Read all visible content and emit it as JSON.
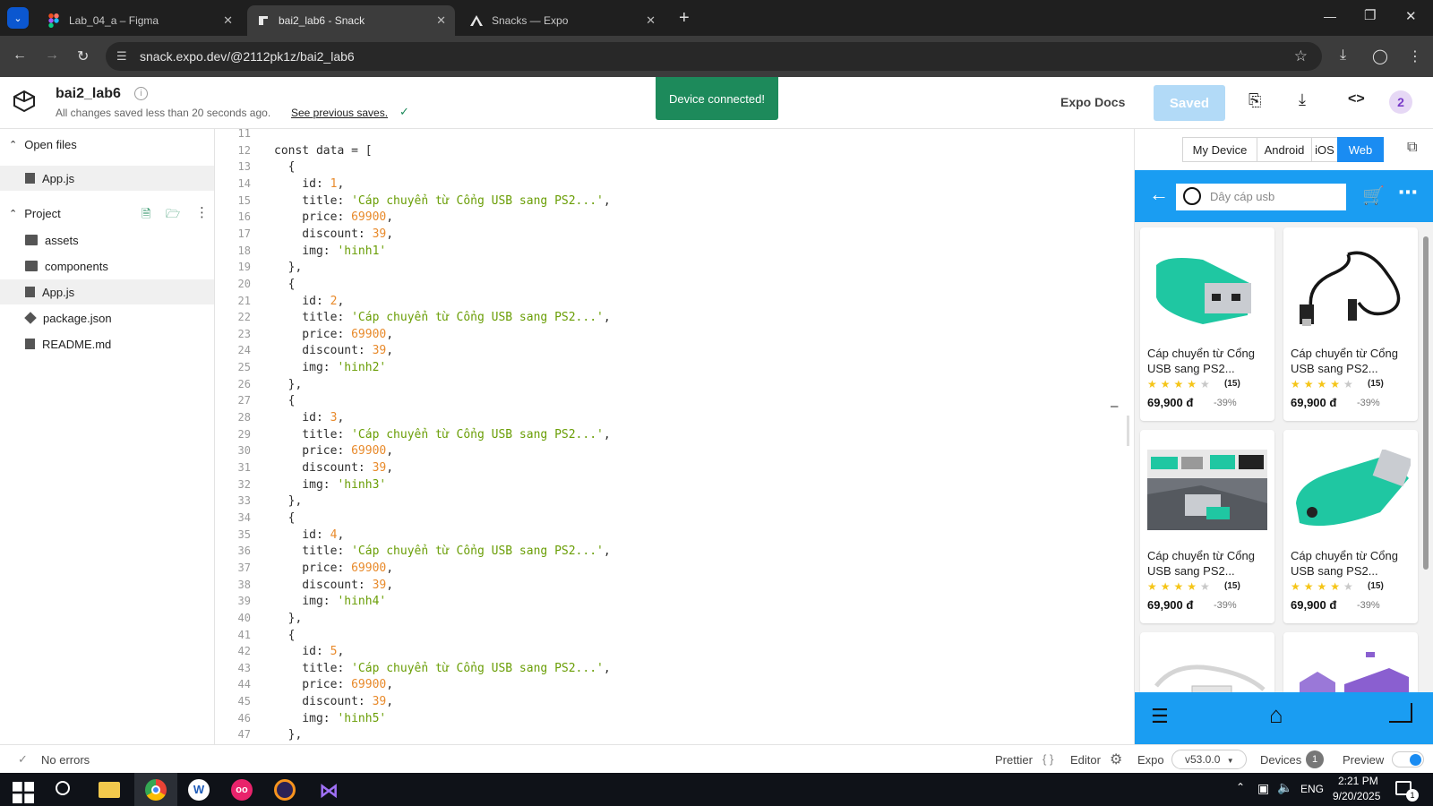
{
  "browser": {
    "tabs": [
      {
        "title": "Lab_04_a – Figma",
        "icon": "figma-icon"
      },
      {
        "title": "bai2_lab6 - Snack",
        "icon": "snack-icon"
      },
      {
        "title": "Snacks — Expo",
        "icon": "expo-icon"
      }
    ],
    "url": "snack.expo.dev/@2112pk1z/bai2_lab6"
  },
  "snack": {
    "project_name": "bai2_lab6",
    "save_status": "All changes saved less than 20 seconds ago.",
    "previous_saves_link": "See previous saves.",
    "toast": "Device connected!",
    "docs_link": "Expo Docs",
    "saved_button": "Saved",
    "avatar_badge": "2"
  },
  "sidebar": {
    "open_files_label": "Open files",
    "open_files": [
      "App.js"
    ],
    "project_label": "Project",
    "items": [
      {
        "name": "assets",
        "type": "folder"
      },
      {
        "name": "components",
        "type": "folder"
      },
      {
        "name": "App.js",
        "type": "js"
      },
      {
        "name": "package.json",
        "type": "package"
      },
      {
        "name": "README.md",
        "type": "md"
      }
    ]
  },
  "editor": {
    "lines": [
      {
        "n": "11",
        "tokens": [
          {
            "t": ""
          }
        ]
      },
      {
        "n": "12",
        "tokens": [
          {
            "t": "const data = ["
          }
        ]
      },
      {
        "n": "13",
        "tokens": [
          {
            "t": "  {"
          }
        ]
      },
      {
        "n": "14",
        "tokens": [
          {
            "t": "    id: "
          },
          {
            "t": "1",
            "c": "num"
          },
          {
            "t": ","
          }
        ]
      },
      {
        "n": "15",
        "tokens": [
          {
            "t": "    title: "
          },
          {
            "t": "'Cáp chuyển từ Cổng USB sang PS2...'",
            "c": "str"
          },
          {
            "t": ","
          }
        ]
      },
      {
        "n": "16",
        "tokens": [
          {
            "t": "    price: "
          },
          {
            "t": "69900",
            "c": "num"
          },
          {
            "t": ","
          }
        ]
      },
      {
        "n": "17",
        "tokens": [
          {
            "t": "    discount: "
          },
          {
            "t": "39",
            "c": "num"
          },
          {
            "t": ","
          }
        ]
      },
      {
        "n": "18",
        "tokens": [
          {
            "t": "    img: "
          },
          {
            "t": "'hinh1'",
            "c": "str"
          }
        ]
      },
      {
        "n": "19",
        "tokens": [
          {
            "t": "  },"
          }
        ]
      },
      {
        "n": "20",
        "tokens": [
          {
            "t": "  {"
          }
        ]
      },
      {
        "n": "21",
        "tokens": [
          {
            "t": "    id: "
          },
          {
            "t": "2",
            "c": "num"
          },
          {
            "t": ","
          }
        ]
      },
      {
        "n": "22",
        "tokens": [
          {
            "t": "    title: "
          },
          {
            "t": "'Cáp chuyển từ Cổng USB sang PS2...'",
            "c": "str"
          },
          {
            "t": ","
          }
        ]
      },
      {
        "n": "23",
        "tokens": [
          {
            "t": "    price: "
          },
          {
            "t": "69900",
            "c": "num"
          },
          {
            "t": ","
          }
        ]
      },
      {
        "n": "24",
        "tokens": [
          {
            "t": "    discount: "
          },
          {
            "t": "39",
            "c": "num"
          },
          {
            "t": ","
          }
        ]
      },
      {
        "n": "25",
        "tokens": [
          {
            "t": "    img: "
          },
          {
            "t": "'hinh2'",
            "c": "str"
          }
        ]
      },
      {
        "n": "26",
        "tokens": [
          {
            "t": "  },"
          }
        ]
      },
      {
        "n": "27",
        "tokens": [
          {
            "t": "  {"
          }
        ]
      },
      {
        "n": "28",
        "tokens": [
          {
            "t": "    id: "
          },
          {
            "t": "3",
            "c": "num"
          },
          {
            "t": ","
          }
        ]
      },
      {
        "n": "29",
        "tokens": [
          {
            "t": "    title: "
          },
          {
            "t": "'Cáp chuyển từ Cổng USB sang PS2...'",
            "c": "str"
          },
          {
            "t": ","
          }
        ]
      },
      {
        "n": "30",
        "tokens": [
          {
            "t": "    price: "
          },
          {
            "t": "69900",
            "c": "num"
          },
          {
            "t": ","
          }
        ]
      },
      {
        "n": "31",
        "tokens": [
          {
            "t": "    discount: "
          },
          {
            "t": "39",
            "c": "num"
          },
          {
            "t": ","
          }
        ]
      },
      {
        "n": "32",
        "tokens": [
          {
            "t": "    img: "
          },
          {
            "t": "'hinh3'",
            "c": "str"
          }
        ]
      },
      {
        "n": "33",
        "tokens": [
          {
            "t": "  },"
          }
        ]
      },
      {
        "n": "34",
        "tokens": [
          {
            "t": "  {"
          }
        ]
      },
      {
        "n": "35",
        "tokens": [
          {
            "t": "    id: "
          },
          {
            "t": "4",
            "c": "num"
          },
          {
            "t": ","
          }
        ]
      },
      {
        "n": "36",
        "tokens": [
          {
            "t": "    title: "
          },
          {
            "t": "'Cáp chuyển từ Cổng USB sang PS2...'",
            "c": "str"
          },
          {
            "t": ","
          }
        ]
      },
      {
        "n": "37",
        "tokens": [
          {
            "t": "    price: "
          },
          {
            "t": "69900",
            "c": "num"
          },
          {
            "t": ","
          }
        ]
      },
      {
        "n": "38",
        "tokens": [
          {
            "t": "    discount: "
          },
          {
            "t": "39",
            "c": "num"
          },
          {
            "t": ","
          }
        ]
      },
      {
        "n": "39",
        "tokens": [
          {
            "t": "    img: "
          },
          {
            "t": "'hinh4'",
            "c": "str"
          }
        ]
      },
      {
        "n": "40",
        "tokens": [
          {
            "t": "  },"
          }
        ]
      },
      {
        "n": "41",
        "tokens": [
          {
            "t": "  {"
          }
        ]
      },
      {
        "n": "42",
        "tokens": [
          {
            "t": "    id: "
          },
          {
            "t": "5",
            "c": "num"
          },
          {
            "t": ","
          }
        ]
      },
      {
        "n": "43",
        "tokens": [
          {
            "t": "    title: "
          },
          {
            "t": "'Cáp chuyển từ Cổng USB sang PS2...'",
            "c": "str"
          },
          {
            "t": ","
          }
        ]
      },
      {
        "n": "44",
        "tokens": [
          {
            "t": "    price: "
          },
          {
            "t": "69900",
            "c": "num"
          },
          {
            "t": ","
          }
        ]
      },
      {
        "n": "45",
        "tokens": [
          {
            "t": "    discount: "
          },
          {
            "t": "39",
            "c": "num"
          },
          {
            "t": ","
          }
        ]
      },
      {
        "n": "46",
        "tokens": [
          {
            "t": "    img: "
          },
          {
            "t": "'hinh5'",
            "c": "str"
          }
        ]
      },
      {
        "n": "47",
        "tokens": [
          {
            "t": "  },"
          }
        ]
      }
    ]
  },
  "device": {
    "tabs": [
      "My Device",
      "Android",
      "iOS",
      "Web"
    ],
    "active_tab": "Web",
    "app": {
      "search_placeholder": "Dây cáp usb",
      "products": [
        {
          "title": "Cáp chuyển từ Cổng USB sang PS2...",
          "rating": 4,
          "reviews": "(15)",
          "price": "69,900 đ",
          "discount": "-39%",
          "image": "green-usb-ps2-adapter"
        },
        {
          "title": "Cáp chuyển từ Cổng USB sang PS2...",
          "rating": 4,
          "reviews": "(15)",
          "price": "69,900 đ",
          "discount": "-39%",
          "image": "black-usb-cable"
        },
        {
          "title": "Cáp chuyển từ Cổng USB sang PS2...",
          "rating": 4,
          "reviews": "(15)",
          "price": "69,900 đ",
          "discount": "-39%",
          "image": "usb-ps2-adapters-closeup"
        },
        {
          "title": "Cáp chuyển từ Cổng USB sang PS2...",
          "rating": 4,
          "reviews": "(15)",
          "price": "69,900 đ",
          "discount": "-39%",
          "image": "green-usb-ps2-adapter-angled"
        },
        {
          "title": "",
          "rating": 0,
          "reviews": "",
          "price": "",
          "discount": "",
          "image": "white-usb-cable-partial"
        },
        {
          "title": "",
          "rating": 0,
          "reviews": "",
          "price": "",
          "discount": "",
          "image": "purple-ps2-adapter-partial"
        }
      ]
    }
  },
  "statusbar": {
    "errors": "No errors",
    "prettier": "Prettier",
    "editor": "Editor",
    "expo": "Expo",
    "sdk_version": "v53.0.0",
    "devices": "Devices",
    "devices_count": "1",
    "preview": "Preview"
  },
  "taskbar": {
    "lang": "ENG",
    "time": "2:21 PM",
    "date": "9/20/2025",
    "notifications": "1"
  },
  "colors": {
    "accent_blue": "#1a9df2",
    "toast_green": "#1d8a5b",
    "saved_button": "#b2daf7"
  }
}
